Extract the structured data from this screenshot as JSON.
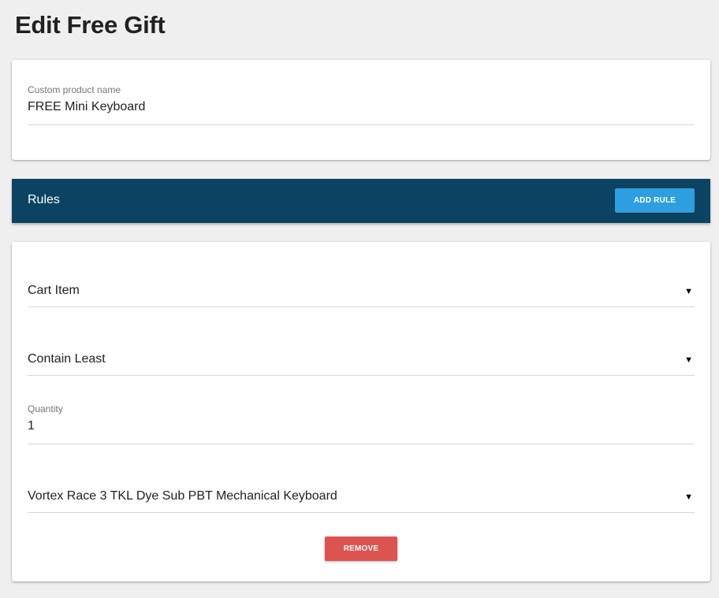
{
  "page": {
    "title": "Edit Free Gift"
  },
  "product_name": {
    "label": "Custom product name",
    "value": "FREE Mini Keyboard"
  },
  "rules": {
    "title": "Rules",
    "add_label": "ADD RULE"
  },
  "rule": {
    "subject": {
      "selected": "Cart Item"
    },
    "condition": {
      "selected": "Contain Least"
    },
    "quantity": {
      "label": "Quantity",
      "value": "1"
    },
    "product": {
      "selected": "Vortex Race 3 TKL Dye Sub PBT Mechanical Keyboard"
    },
    "remove_label": "REMOVE"
  },
  "icons": {
    "dropdown_arrow": "▼"
  },
  "colors": {
    "background": "#efefef",
    "rules_bar": "#0a4462",
    "add_button": "#2d9ee0",
    "remove_button": "#dd5350"
  }
}
